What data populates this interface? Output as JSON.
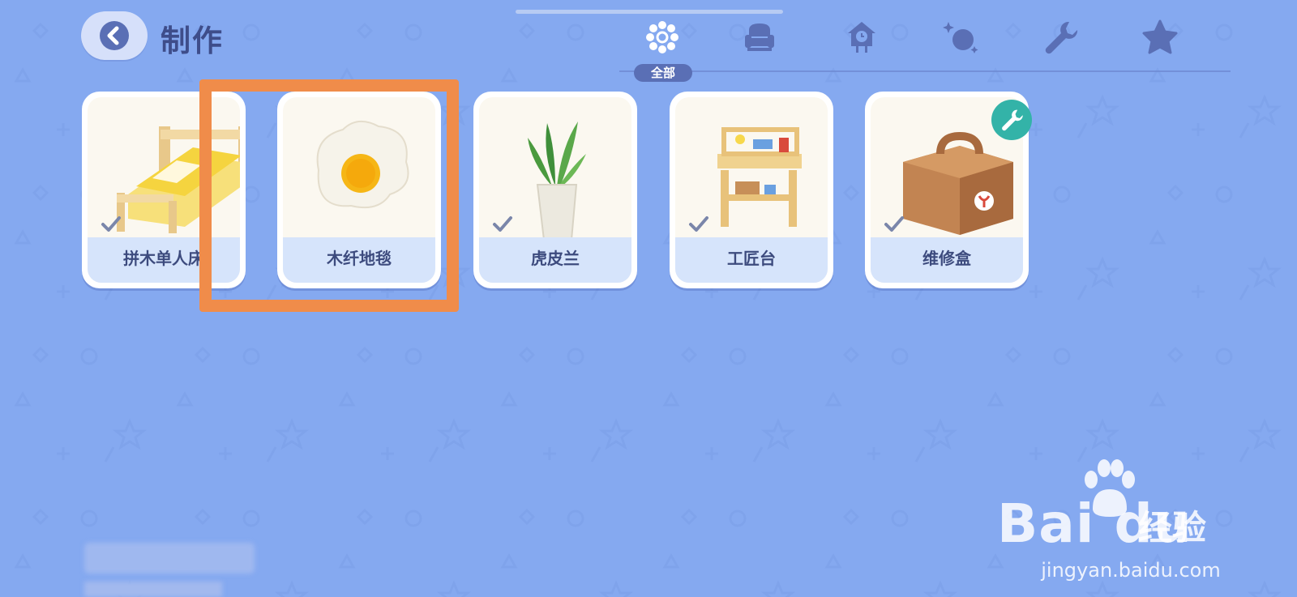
{
  "header": {
    "title": "制作",
    "back_icon": "chevron-left-icon"
  },
  "tabs": [
    {
      "icon": "all-grid-icon",
      "label": "全部",
      "selected": true
    },
    {
      "icon": "armchair-icon",
      "selected": false
    },
    {
      "icon": "cuckoo-clock-icon",
      "selected": false
    },
    {
      "icon": "sparkle-ball-icon",
      "selected": false
    },
    {
      "icon": "wrench-icon",
      "selected": false
    },
    {
      "icon": "star-icon",
      "selected": false
    }
  ],
  "items": [
    {
      "name": "拼木单人床",
      "icon": "wooden-bed-icon",
      "crafted": true
    },
    {
      "name": "木纤地毯",
      "icon": "fried-egg-rug-icon",
      "crafted": false
    },
    {
      "name": "虎皮兰",
      "icon": "snake-plant-icon",
      "crafted": true
    },
    {
      "name": "工匠台",
      "icon": "workbench-icon",
      "crafted": true
    },
    {
      "name": "维修盒",
      "icon": "repair-box-icon",
      "crafted": true,
      "badge": "wrench-badge-icon"
    }
  ],
  "watermark": {
    "brand": "Bai du",
    "cn": "经验",
    "url": "jingyan.baidu.com"
  },
  "colors": {
    "background": "#85a9f0",
    "highlight": "#f08c4a",
    "badge": "#33b3a8"
  }
}
